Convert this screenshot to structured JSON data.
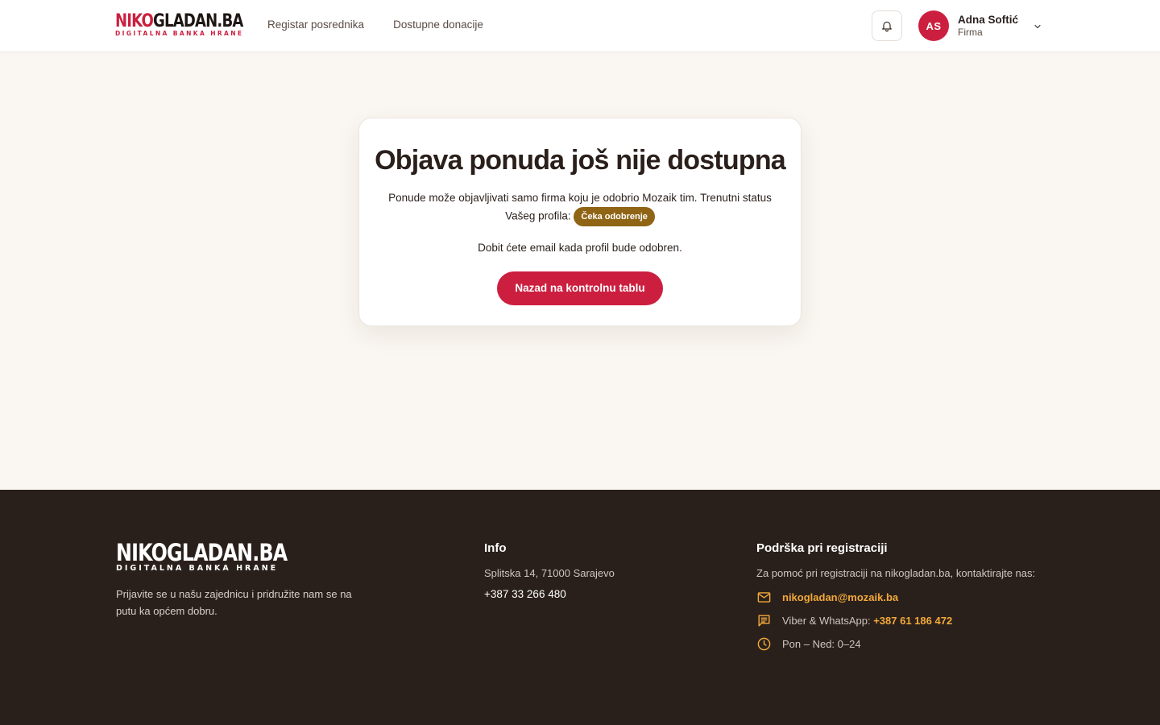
{
  "header": {
    "logo_part1": "NIKO",
    "logo_part2": "GLADAN.BA",
    "logo_sub": "DIGITALNA BANKA HRANE",
    "nav": [
      {
        "label": "Registar posrednika"
      },
      {
        "label": "Dostupne donacije"
      }
    ],
    "user": {
      "initials": "AS",
      "name": "Adna Softić",
      "role": "Firma"
    }
  },
  "card": {
    "title": "Objava ponuda još nije dostupna",
    "text": "Ponude može objavljivati samo firma koju je odobrio Mozaik tim. Trenutni status Vašeg profila:",
    "status_badge": "Čeka odobrenje",
    "email_note": "Dobit ćete email kada profil bude odobren.",
    "button_label": "Nazad na kontrolnu tablu"
  },
  "footer": {
    "logo_main": "NIKOGLADAN.BA",
    "logo_sub": "DIGITALNA BANKA HRANE",
    "tagline": "Prijavite se u našu zajednicu i pridružite nam se na putu ka općem dobru.",
    "info": {
      "heading": "Info",
      "address": "Splitska 14, 71000 Sarajevo",
      "phone": "+387 33 266 480"
    },
    "support": {
      "heading": "Podrška pri registraciji",
      "text": "Za pomoć pri registraciji na nikogladan.ba, kontaktirajte nas:",
      "email": "nikogladan@mozaik.ba",
      "chat_label": "Viber & WhatsApp:",
      "chat_phone": "+387 61 186 472",
      "hours": "Pon – Ned: 0–24"
    }
  },
  "colors": {
    "brand_red": "#cc1f3f",
    "badge_amber": "#8f6415",
    "footer_bg": "#2a201b",
    "accent_orange": "#f2a93b",
    "page_bg": "#faf6f1"
  },
  "icons": [
    "bell-icon",
    "chevron-down-icon",
    "mail-icon",
    "chat-icon",
    "clock-icon"
  ]
}
